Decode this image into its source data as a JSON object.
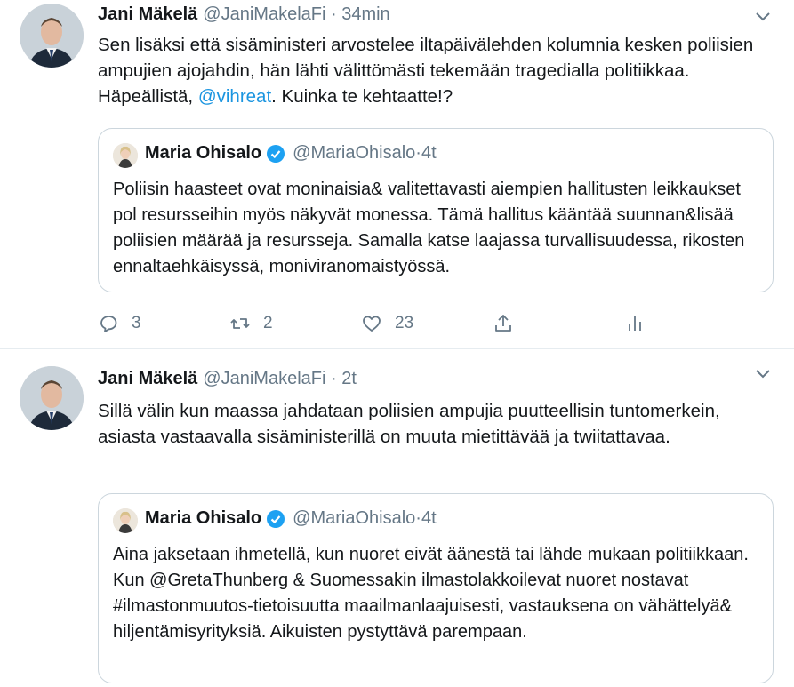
{
  "tweets": [
    {
      "author_name": "Jani Mäkelä",
      "author_handle": "@JaniMakelaFi",
      "time": "34min",
      "text_before_mention": "Sen lisäksi että sisäministeri arvostelee iltapäivälehden kolumnia kesken poliisien ampujien ajojahdin, hän lähti välittömästi tekemään tragedialla politiikkaa. Häpeällistä, ",
      "mention": "@vihreat",
      "text_after_mention": ". Kuinka te kehtaatte!?",
      "quote": {
        "author_name": "Maria Ohisalo",
        "author_handle": "@MariaOhisalo",
        "time": "4t",
        "text": "Poliisin haasteet ovat moninaisia& valitettavasti aiempien hallitusten leikkaukset pol resursseihin myös näkyvät monessa. Tämä hallitus kääntää suunnan&lisää poliisien määrää ja resursseja. Samalla katse laajassa turvallisuudessa, rikosten ennaltaehkäisyssä, moniviranomaistyössä."
      },
      "actions": {
        "replies": "3",
        "retweets": "2",
        "likes": "23"
      }
    },
    {
      "author_name": "Jani Mäkelä",
      "author_handle": "@JaniMakelaFi",
      "time": "2t",
      "text": "Sillä välin kun maassa jahdataan poliisien ampujia puutteellisin tuntomerkein, asiasta vastaavalla sisäministerillä on muuta mietittävää ja twiitattavaa.",
      "quote": {
        "author_name": "Maria Ohisalo",
        "author_handle": "@MariaOhisalo",
        "time": "4t",
        "text": "Aina jaksetaan ihmetellä, kun nuoret eivät äänestä tai lähde mukaan politiikkaan. Kun @GretaThunberg & Suomessakin ilmastolakkoilevat nuoret nostavat #ilmastonmuutos-tietoisuutta maailmanlaajuisesti, vastauksena on vähättelyä& hiljentämisyrityksiä. Aikuisten pystyttävä parempaan."
      }
    }
  ],
  "separator": " · ",
  "colors": {
    "link": "#1b95e0",
    "muted": "#657786",
    "border": "#ccd6dd",
    "verified": "#1da1f2"
  },
  "icons": [
    "caret-down-icon",
    "verified-badge-icon",
    "reply-icon",
    "retweet-icon",
    "like-icon",
    "share-icon",
    "analytics-icon"
  ]
}
